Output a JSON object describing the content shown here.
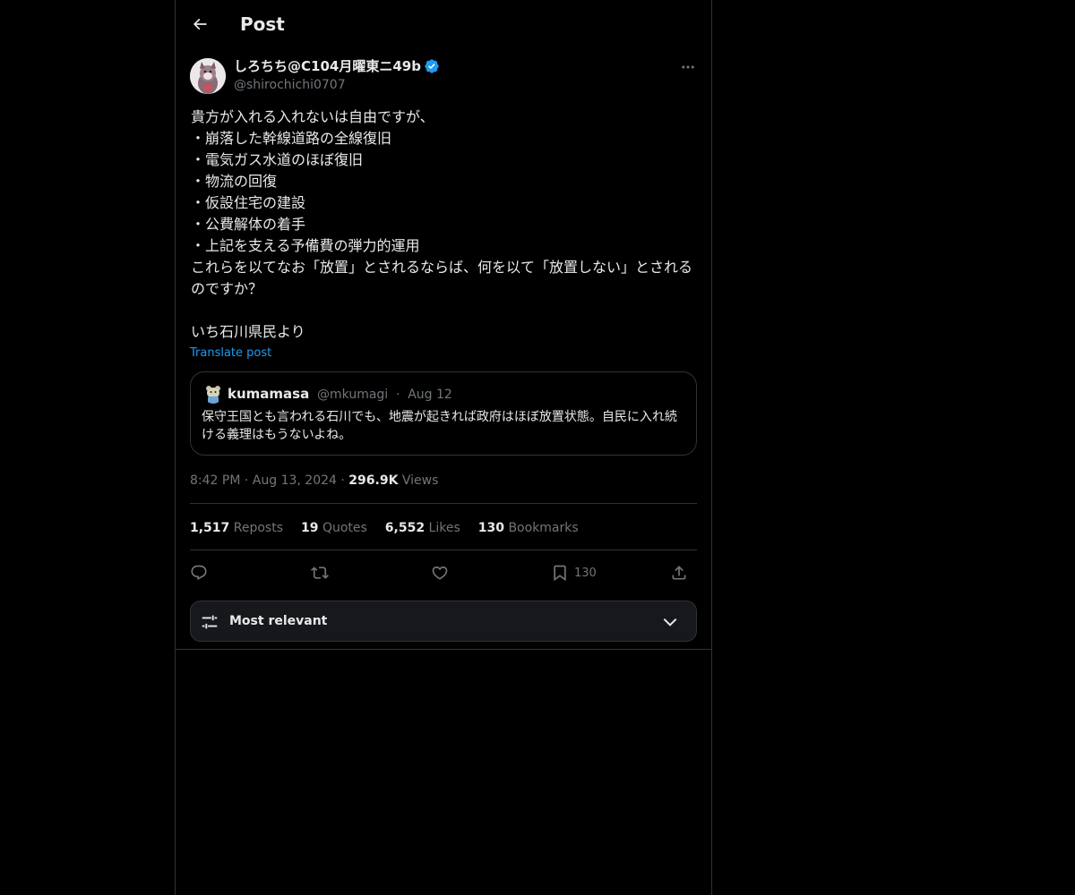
{
  "header": {
    "title": "Post",
    "back_icon": "arrow-left-icon"
  },
  "post": {
    "author_name": "しろちち@C104月曜東ニ49b",
    "author_handle": "@shirochichi0707",
    "verified": true,
    "text": "貴方が入れる入れないは自由ですが、\n・崩落した幹線道路の全線復旧\n・電気ガス水道のほぼ復旧\n・物流の回復\n・仮設住宅の建設\n・公費解体の着手\n・上記を支える予備費の弾力的運用\nこれらを以てなお「放置」とされるならば、何を以て「放置しない」とされるのですか？\n\nいち石川県民より",
    "translate_label": "Translate post",
    "time": "8:42 PM",
    "date": "Aug 13, 2024",
    "views_count": "296.9K",
    "views_label": "Views"
  },
  "quote": {
    "name": "kumamasa",
    "handle": "@mkumagi",
    "date": "Aug 12",
    "text": "保守王国とも言われる石川でも、地震が起きれば政府はほぼ放置状態。自民に入れ続ける義理はもうないよね。"
  },
  "stats": {
    "reposts_count": "1,517",
    "reposts_label": "Reposts",
    "quotes_count": "19",
    "quotes_label": "Quotes",
    "likes_count": "6,552",
    "likes_label": "Likes",
    "bookmarks_count": "130",
    "bookmarks_label": "Bookmarks"
  },
  "actions": {
    "reply_icon": "reply-icon",
    "repost_icon": "repost-icon",
    "like_icon": "heart-icon",
    "bookmark_icon": "bookmark-icon",
    "bookmark_count": "130",
    "share_icon": "share-icon"
  },
  "sort": {
    "label": "Most relevant",
    "icon": "sliders-icon",
    "chevron": "chevron-down-icon"
  },
  "colors": {
    "background": "#000000",
    "text": "#e7e9ea",
    "muted": "#71767b",
    "accent": "#1d9bf0",
    "border": "#2f3336"
  }
}
